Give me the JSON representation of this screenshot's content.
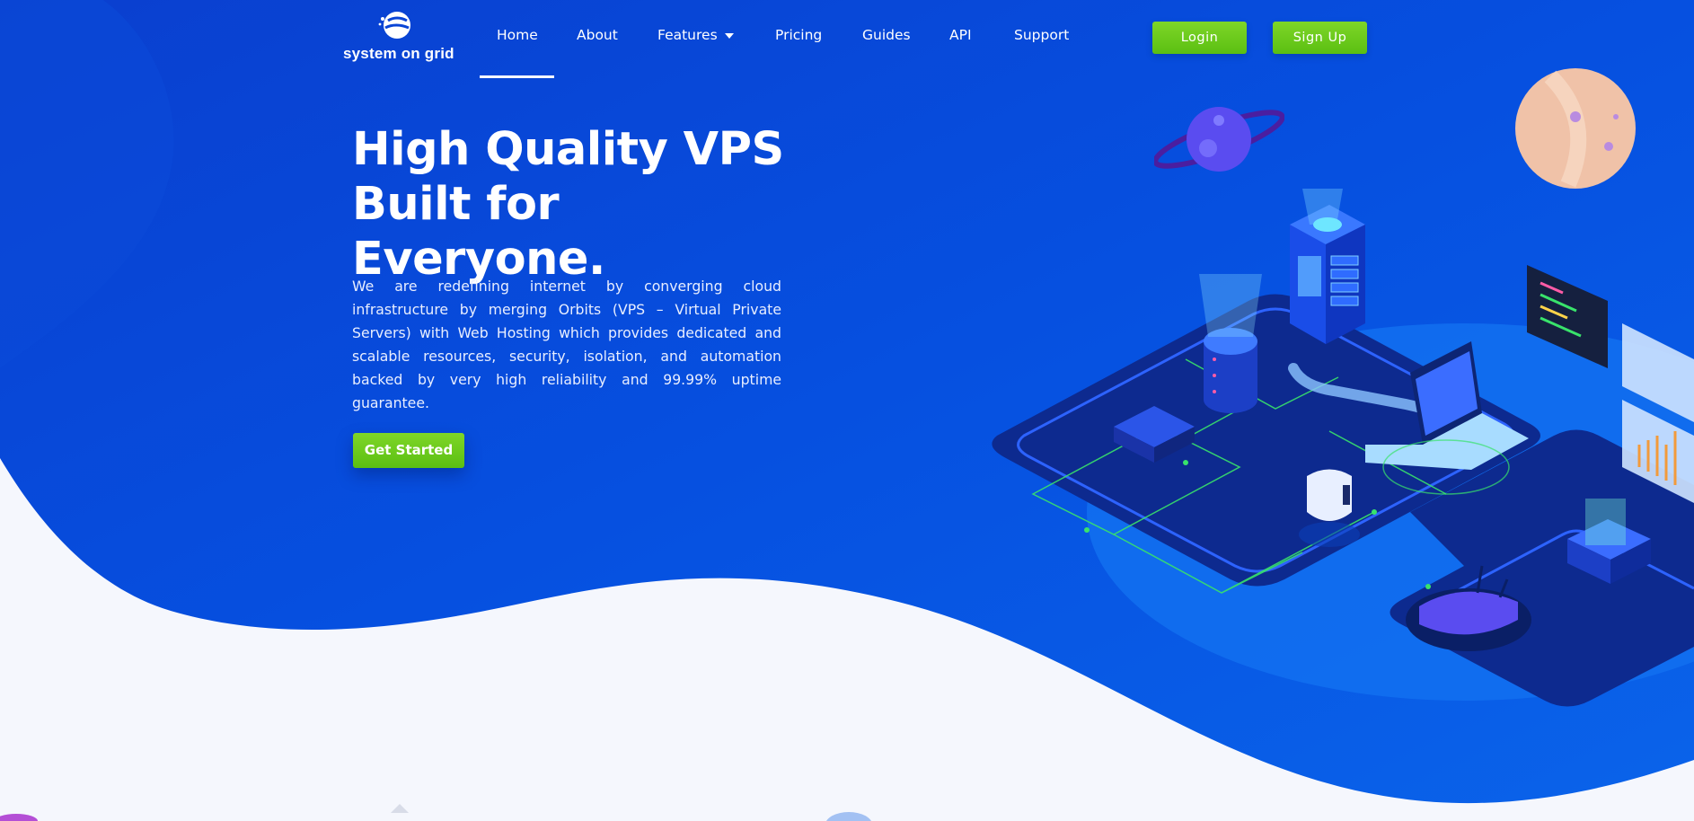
{
  "brand": {
    "name": "system on grid"
  },
  "nav": {
    "items": [
      {
        "label": "Home",
        "active": true
      },
      {
        "label": "About"
      },
      {
        "label": "Features",
        "has_dropdown": true
      },
      {
        "label": "Pricing"
      },
      {
        "label": "Guides"
      },
      {
        "label": "API"
      },
      {
        "label": "Support"
      }
    ],
    "login_label": "Login",
    "signup_label": "Sign Up"
  },
  "hero": {
    "title_line1": "High Quality VPS",
    "title_line2": "Built for Everyone.",
    "description": "We are redefining internet by converging cloud infrastructure by merging Orbits (VPS – Virtual Private Servers) with Web Hosting which provides dedicated and scalable resources, security, isolation, and automation backed by very high reliability and 99.99% uptime guarantee.",
    "cta_label": "Get Started"
  },
  "colors": {
    "hero_blue": "#0a4fd8",
    "accent_green": "#6ccb1e",
    "page_background": "#f5f7fd"
  },
  "icons": {
    "logo": "system-on-grid-logo",
    "features_caret": "caret-down-icon",
    "illustration": "isometric-server-network-illustration"
  }
}
